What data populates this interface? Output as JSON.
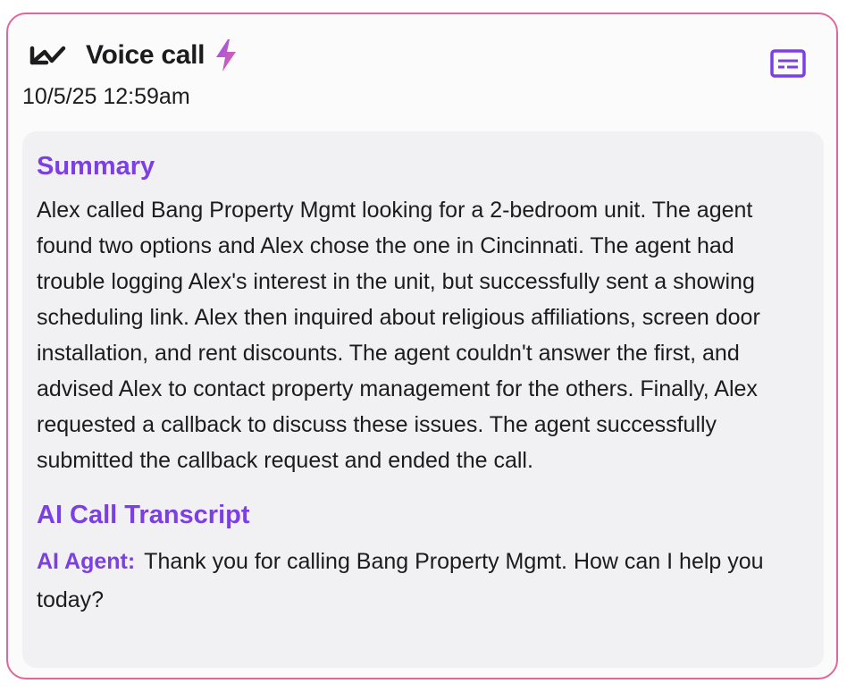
{
  "call": {
    "title": "Voice call",
    "timestamp": "10/5/25 12:59am",
    "direction_icon": "incoming-arrow-icon",
    "type_icon": "lightning-bolt-icon",
    "transcript_icon": "subtitles-icon"
  },
  "summary": {
    "heading": "Summary",
    "text": "Alex called Bang Property Mgmt looking for a 2-bedroom unit. The agent found two options and Alex chose the one in Cincinnati. The agent had trouble logging Alex's interest in the unit, but successfully sent a showing scheduling link. Alex then inquired about religious affiliations, screen door installation, and rent discounts. The agent couldn't answer the first, and advised Alex to contact property management for the others. Finally, Alex requested a callback to discuss these issues. The agent successfully submitted the callback request and ended the call."
  },
  "transcript": {
    "heading": "AI Call Transcript",
    "entries": [
      {
        "speaker": "AI Agent:",
        "text": "Thank you for calling Bang Property Mgmt. How can I help you today?"
      }
    ]
  },
  "colors": {
    "accent": "#7b3fe4",
    "border": "#e0679a",
    "text": "#1c1c1e",
    "panel": "#f1f1f3"
  }
}
